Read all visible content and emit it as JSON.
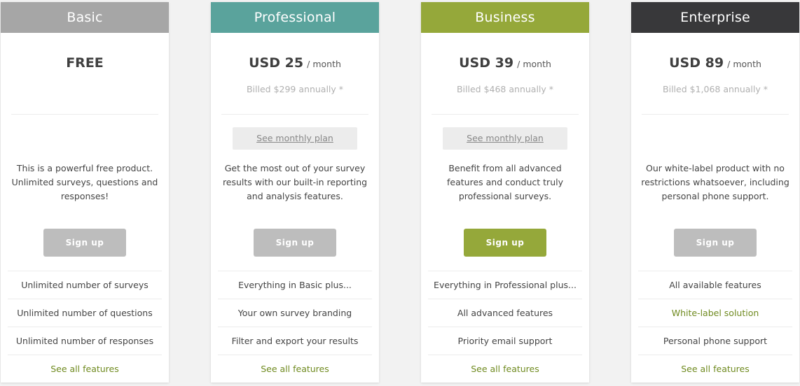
{
  "plans": [
    {
      "name": "Basic",
      "header_color": "#a6a6a6",
      "price": "FREE",
      "period": "",
      "billed": "",
      "monthly_plan_label": "",
      "description": "This is a powerful free product. Unlimited surveys, questions and responses!",
      "signup_label": "Sign up",
      "signup_active": false,
      "features": [
        "Unlimited number of surveys",
        "Unlimited number of questions",
        "Unlimited number of responses"
      ],
      "highlight_features": [],
      "see_all_label": "See all features"
    },
    {
      "name": "Professional",
      "header_color": "#5aa39c",
      "price": "USD 25",
      "period": "/ month",
      "billed": "Billed $299 annually *",
      "monthly_plan_label": "See monthly plan",
      "description": "Get the most out of your survey results with our built-in reporting and analysis features.",
      "signup_label": "Sign up",
      "signup_active": false,
      "features": [
        "Everything in Basic plus...",
        "Your own survey branding",
        "Filter and export your results"
      ],
      "highlight_features": [],
      "see_all_label": "See all features"
    },
    {
      "name": "Business",
      "header_color": "#95a83a",
      "price": "USD 39",
      "period": "/ month",
      "billed": "Billed $468 annually *",
      "monthly_plan_label": "See monthly plan",
      "description": "Benefit from all advanced features and conduct truly professional surveys.",
      "signup_label": "Sign up",
      "signup_active": true,
      "features": [
        "Everything in Professional plus...",
        "All advanced features",
        "Priority email support"
      ],
      "highlight_features": [],
      "see_all_label": "See all features"
    },
    {
      "name": "Enterprise",
      "header_color": "#38383a",
      "price": "USD 89",
      "period": "/ month",
      "billed": "Billed $1,068 annually *",
      "monthly_plan_label": "",
      "description": "Our white-label product with no restrictions whatsoever, including personal phone support.",
      "signup_label": "Sign up",
      "signup_active": false,
      "features": [
        "All available features",
        "White-label solution",
        "Personal phone support"
      ],
      "highlight_features": [
        1
      ],
      "see_all_label": "See all features"
    }
  ]
}
